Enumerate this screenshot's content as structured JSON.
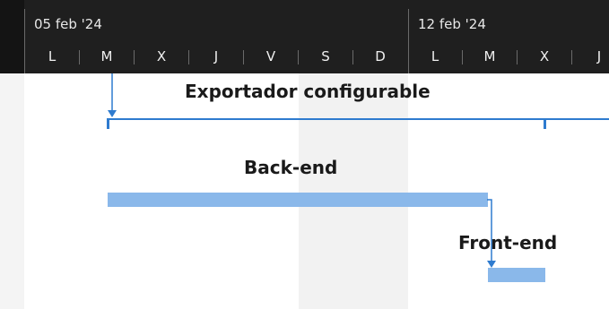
{
  "timeline": {
    "weeks": [
      {
        "label": "05 feb '24"
      },
      {
        "label": "12 feb '24"
      }
    ],
    "days": [
      "L",
      "M",
      "X",
      "J",
      "V",
      "S",
      "D",
      "L",
      "M",
      "X",
      "J"
    ]
  },
  "tasks": {
    "summary": {
      "name": "Exportador configurable"
    },
    "backend": {
      "name": "Back-end"
    },
    "frontend": {
      "name": "Front-end"
    }
  },
  "colors": {
    "header_bg": "#1f1f1f",
    "bar_fill": "#8ab8ea",
    "summary_line": "#2e7bcf",
    "arrow": "#2e7bcf",
    "weekend_shade": "#f2f2f2"
  }
}
